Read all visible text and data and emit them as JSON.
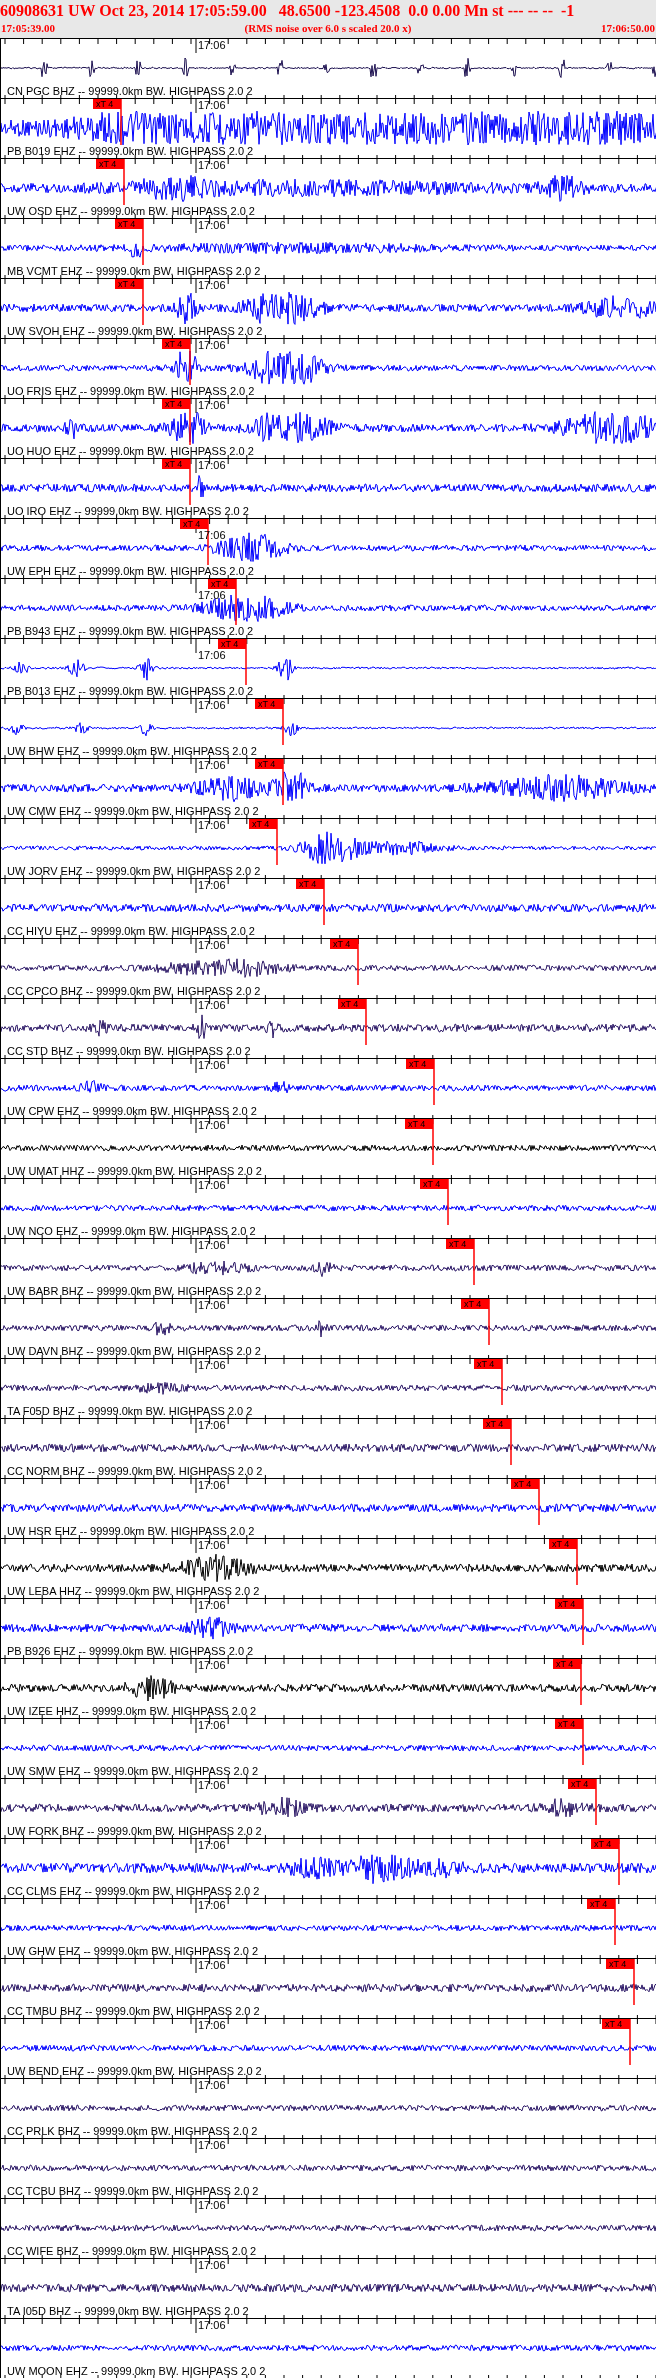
{
  "header": {
    "title": "60908631 UW Oct 23, 2014 17:05:59.00   48.6500 -123.4508  0.0 0.00 Mn st --- -- --  -1",
    "start_time": "17:05:39.00",
    "note": "(RMS noise over 6.0 s scaled 20.0 x)",
    "end_time": "17:06:50.00"
  },
  "traces": [
    {
      "time_label": "17:06",
      "label": "CN PGC BHZ -- 99999.0km BW. HIGHPASS 2.0 2",
      "color": "#1c1050"
    },
    {
      "time_label": "17:06",
      "label": "PB B019 EHZ -- 99999.0km BW. HIGHPASS 2.0 2",
      "color": "#0000ff",
      "pick": "xT 4"
    },
    {
      "time_label": "17:06",
      "label": "UW OSD EHZ -- 99999.0km BW. HIGHPASS 2.0 2",
      "color": "#0000ff",
      "pick": "xT 4"
    },
    {
      "time_label": "17:06",
      "label": "MB VCMT EHZ -- 99999.0km BW. HIGHPASS 2.0 2",
      "color": "#0000ff",
      "pick": "xT 4"
    },
    {
      "time_label": "17:06",
      "label": "UW SVOH EHZ -- 99999.0km BW. HIGHPASS 2.0 2",
      "color": "#0000ff",
      "pick": "xT 4"
    },
    {
      "time_label": "17:06",
      "label": "UO FRIS EHZ -- 99999.0km BW. HIGHPASS 2.0 2",
      "color": "#0000ff",
      "pick": "xT 4"
    },
    {
      "time_label": "17:06",
      "label": "UO HUO EHZ -- 99999.0km BW. HIGHPASS 2.0 2",
      "color": "#0000ff",
      "pick": "xT 4"
    },
    {
      "time_label": "17:06",
      "label": "UO IRO EHZ -- 99999.0km BW. HIGHPASS 2.0 2",
      "color": "#0000ff",
      "pick": "xT 4"
    },
    {
      "time_label": "17:06",
      "label": "UW EPH EHZ -- 99999.0km BW. HIGHPASS 2.0 2",
      "color": "#0000ff",
      "pick": "xT 4"
    },
    {
      "time_label": "17:06",
      "label": "PB B943 EHZ -- 99999.0km BW. HIGHPASS 2.0 2",
      "color": "#0000ff",
      "pick": "xT 4"
    },
    {
      "time_label": "17:06",
      "label": "PB B013 EHZ -- 99999.0km BW. HIGHPASS 2.0 2",
      "color": "#0000ff",
      "pick": "xT 4"
    },
    {
      "time_label": "17:06",
      "label": "UW BHW EHZ -- 99999.0km BW. HIGHPASS 2.0 2",
      "color": "#0000ff",
      "pick": "xT 4"
    },
    {
      "time_label": "17:06",
      "label": "UW CMW EHZ -- 99999.0km BW. HIGHPASS 2.0 2",
      "color": "#0000ff",
      "pick": "xT 4"
    },
    {
      "time_label": "17:06",
      "label": "UW JORV EHZ -- 99999.0km BW. HIGHPASS 2.0 2",
      "color": "#0000ff",
      "pick": "xT 4"
    },
    {
      "time_label": "17:06",
      "label": "CC HIYU EHZ -- 99999.0km BW. HIGHPASS 2.0 2",
      "color": "#0000ff",
      "pick": "xT 4"
    },
    {
      "time_label": "17:06",
      "label": "CC CPCO BHZ -- 99999.0km BW. HIGHPASS 2.0 2",
      "color": "#2b1766",
      "pick": "xT 4"
    },
    {
      "time_label": "17:06",
      "label": "CC STD BHZ -- 99999.0km BW. HIGHPASS 2.0 2",
      "color": "#2b1766",
      "pick": "xT 4"
    },
    {
      "time_label": "17:06",
      "label": "UW CPW EHZ -- 99999.0km BW. HIGHPASS 2.0 2",
      "color": "#0000ff",
      "pick": "xT 4"
    },
    {
      "time_label": "17:06",
      "label": "UW UMAT HHZ -- 99999.0km BW. HIGHPASS 2.0 2",
      "color": "#000000",
      "pick": "xT 4"
    },
    {
      "time_label": "17:06",
      "label": "UW NCO EHZ -- 99999.0km BW. HIGHPASS 2.0 2",
      "color": "#0000ff",
      "pick": "xT 4"
    },
    {
      "time_label": "17:06",
      "label": "UW BABR BHZ -- 99999.0km BW. HIGHPASS 2.0 2",
      "color": "#2b1766",
      "pick": "xT 4"
    },
    {
      "time_label": "17:06",
      "label": "UW DAVN BHZ -- 99999.0km BW. HIGHPASS 2.0 2",
      "color": "#2b1766",
      "pick": "xT 4"
    },
    {
      "time_label": "17:06",
      "label": "TA F05D BHZ -- 99999.0km BW. HIGHPASS 2.0 2",
      "color": "#2b1766",
      "pick": "xT 4"
    },
    {
      "time_label": "17:06",
      "label": "CC NORM BHZ -- 99999.0km BW. HIGHPASS 2.0 2",
      "color": "#2b1766",
      "pick": "xT 4"
    },
    {
      "time_label": "17:06",
      "label": "UW HSR EHZ -- 99999.0km BW. HIGHPASS 2.0 2",
      "color": "#0000ff",
      "pick": "xT 4"
    },
    {
      "time_label": "17:06",
      "label": "UW LEBA HHZ -- 99999.0km BW. HIGHPASS 2.0 2",
      "color": "#000000",
      "pick": "xT 4"
    },
    {
      "time_label": "17:06",
      "label": "PB B926 EHZ -- 99999.0km BW. HIGHPASS 2.0 2",
      "color": "#0000ff",
      "pick": "xT 4"
    },
    {
      "time_label": "17:06",
      "label": "UW IZEE HHZ -- 99999.0km BW. HIGHPASS 2.0 2",
      "color": "#000000",
      "pick": "xT 4"
    },
    {
      "time_label": "17:06",
      "label": "UW SMW EHZ -- 99999.0km BW. HIGHPASS 2.0 2",
      "color": "#0000ff",
      "pick": "xT 4"
    },
    {
      "time_label": "17:06",
      "label": "UW FORK BHZ -- 99999.0km BW. HIGHPASS 2.0 2",
      "color": "#2b1766",
      "pick": "xT 4"
    },
    {
      "time_label": "17:06",
      "label": "CC CLMS EHZ -- 99999.0km BW. HIGHPASS 2.0 2",
      "color": "#0000ff",
      "pick": "xT 4"
    },
    {
      "time_label": "17:06",
      "label": "UW GHW EHZ -- 99999.0km BW. HIGHPASS 2.0 2",
      "color": "#0000ff",
      "pick": "xT 4"
    },
    {
      "time_label": "17:06",
      "label": "CC TMBU BHZ -- 99999.0km BW. HIGHPASS 2.0 2",
      "color": "#2b1766",
      "pick": "xT 4"
    },
    {
      "time_label": "17:06",
      "label": "UW BEND EHZ -- 99999.0km BW. HIGHPASS 2.0 2",
      "color": "#0000ff",
      "pick": "xT 4"
    },
    {
      "time_label": "17:06",
      "label": "CC PRLK BHZ -- 99999.0km BW. HIGHPASS 2.0 2",
      "color": "#2b1766"
    },
    {
      "time_label": "17:06",
      "label": "CC TCBU BHZ -- 99999.0km BW. HIGHPASS 2.0 2",
      "color": "#2b1766"
    },
    {
      "time_label": "17:06",
      "label": "CC WIFE BHZ -- 99999.0km BW. HIGHPASS 2.0 2",
      "color": "#2b1766"
    },
    {
      "time_label": "17:06",
      "label": "TA I05D BHZ -- 99999.0km BW. HIGHPASS 2.0 2",
      "color": "#2b1766"
    },
    {
      "time_label": "17:06",
      "label": "UW MOON EHZ -- 99999.0km BW. HIGHPASS 2.0 2",
      "color": "#0000ff"
    }
  ]
}
